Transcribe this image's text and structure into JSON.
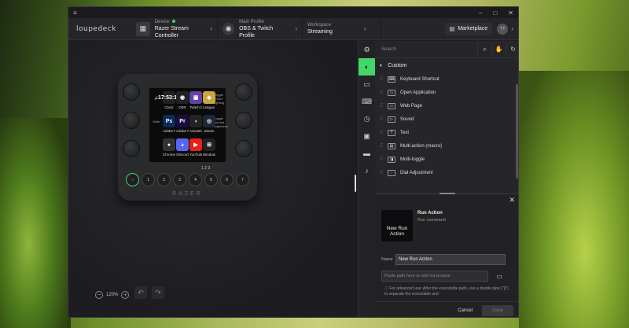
{
  "titlebar": {
    "menu_icon": "hamburger-icon"
  },
  "header": {
    "logo": "loupedeck",
    "device": {
      "label": "Device",
      "value": "Razer Stream Controller"
    },
    "profile": {
      "label": "Main Profile",
      "value": "OBS & Twitch Profile"
    },
    "workspace": {
      "label": "Workspace",
      "value": "Streaming"
    },
    "marketplace": "Marketplace",
    "avatar": "TT"
  },
  "device": {
    "brand": "RAZER",
    "tiles": [
      {
        "label": "Clock",
        "icon": "17:53:16",
        "color": "#222"
      },
      {
        "label": "OBS",
        "icon": "◉",
        "color": "#222"
      },
      {
        "label": "Twitch D...",
        "icon": "▣",
        "color": "#6441a5"
      },
      {
        "label": "League o...",
        "icon": "◆",
        "color": "#c8a640"
      },
      {
        "label": "Adobe P...",
        "icon": "Ps",
        "color": "#0b2a55"
      },
      {
        "label": "Adobe Pr...",
        "icon": "Pr",
        "color": "#1a0b40"
      },
      {
        "label": "Activatio...",
        "icon": "◖",
        "color": "#222"
      },
      {
        "label": "Steam",
        "icon": "◎",
        "color": "#1b2838"
      },
      {
        "label": "Chrome",
        "icon": "●",
        "color": "#333"
      },
      {
        "label": "Discord",
        "icon": "◕",
        "color": "#5865f2"
      },
      {
        "label": "YouTube",
        "icon": "▶",
        "color": "#e62117"
      },
      {
        "label": "Windows...",
        "icon": "⊞",
        "color": "#222"
      }
    ],
    "left_labels": [
      "🔊",
      "Mute",
      ""
    ],
    "right_labels": [
      "Toggle Food Lighting",
      "Toggle Chroma Brightness",
      ""
    ],
    "pages": "1 2 3",
    "buttons": [
      "○",
      "1",
      "2",
      "3",
      "4",
      "5",
      "6",
      "7"
    ]
  },
  "canvas": {
    "zoom": "120%"
  },
  "panel": {
    "search_placeholder": "Search",
    "category": "Custom",
    "actions": [
      "Keyboard Shortcut",
      "Open Application",
      "Web Page",
      "Sound",
      "Text",
      "Multi-action (macro)",
      "Multi-toggle",
      "Dial Adjustment"
    ],
    "detail": {
      "thumb_line1": "New Run",
      "thumb_line2": "Action",
      "title": "Run Action",
      "subtitle": "Run command",
      "name_label": "Name",
      "name_value": "New Run Action",
      "path_placeholder": "Paste path here or add via browse",
      "help": "For advanced use: After the executable path, use a double pipe (\"||\") to separate the executable and",
      "cancel": "Cancel",
      "save": "Save"
    }
  },
  "colors": {
    "accent": "#43d66b"
  }
}
